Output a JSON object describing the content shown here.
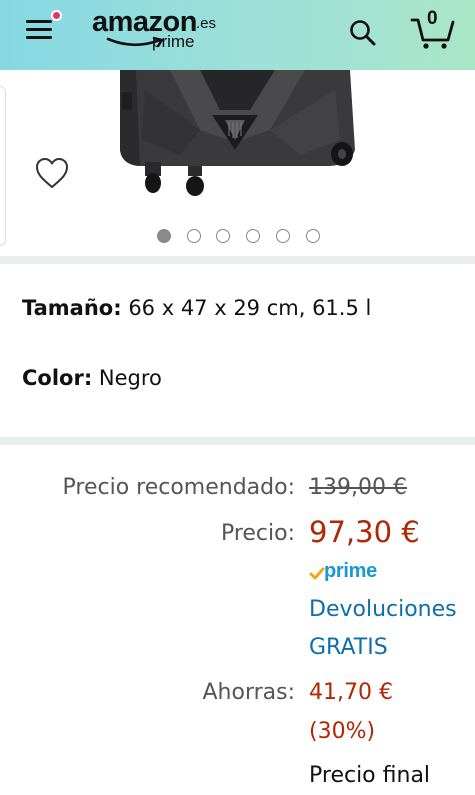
{
  "header": {
    "logo_text": "amazon",
    "logo_domain": ".es",
    "logo_prime": "prime",
    "cart_count": "0",
    "background_gradient": [
      "#84d8e3",
      "#a9e6c8"
    ]
  },
  "icons": {
    "menu": "hamburger-menu-icon",
    "notification": "notification-dot",
    "search": "search-icon",
    "cart": "cart-icon",
    "wishlist": "heart-icon"
  },
  "carousel": {
    "total_images": 6,
    "active_index": 0
  },
  "variations": {
    "size_label": "Tamaño:",
    "size_value": "66 x 47 x 29 cm, 61.5 l",
    "color_label": "Color:",
    "color_value": "Negro"
  },
  "pricing": {
    "list_price_label": "Precio recomendado:",
    "list_price_value": "139,00 €",
    "price_label": "Precio:",
    "price_value": "97,30 €",
    "prime_label": "prime",
    "returns_line1": "Devoluciones",
    "returns_line2": "GRATIS",
    "savings_label": "Ahorras:",
    "savings_value": "41,70 €",
    "savings_percent": "(30%)",
    "final_price_label": "Precio final"
  },
  "colors": {
    "price_red": "#b12704",
    "link_blue": "#0f6fa8",
    "prime_check": "#f7a21b",
    "prime_text": "#1a98d5"
  }
}
